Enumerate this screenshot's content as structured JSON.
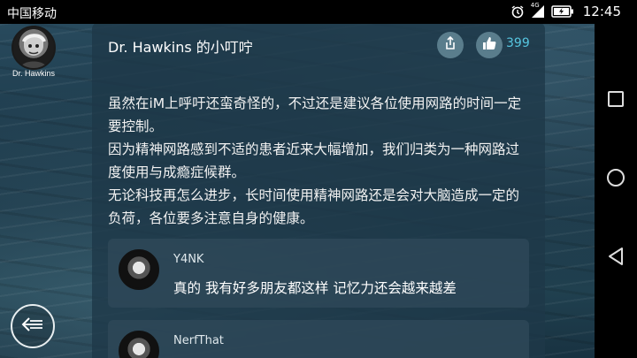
{
  "status_bar": {
    "carrier": "中国移动",
    "network_badge": "4G",
    "time": "12:45"
  },
  "author": {
    "name": "Dr. Hawkins"
  },
  "post": {
    "title": "Dr. Hawkins 的小叮咛",
    "like_count": "399",
    "paragraphs": [
      "虽然在iM上呼吁还蛮奇怪的，不过还是建议各位使用网路的时间一定要控制。",
      "因为精神网路感到不适的患者近来大幅增加，我们归类为一种网路过度使用与成瘾症候群。",
      "无论科技再怎么进步，长时间使用精神网路还是会对大脑造成一定的负荷，各位要多注意自身的健康。"
    ]
  },
  "comments": [
    {
      "user": "Y4NK",
      "text": "真的 我有好多朋友都这样 记忆力还会越来越差"
    },
    {
      "user": "NerfThat",
      "text": ""
    }
  ],
  "colors": {
    "accent": "#56c6e0",
    "card_bg": "#1e3848",
    "button_bg": "#5a7d8c"
  },
  "icons": {
    "share": "share-icon",
    "like": "thumbs-up-icon",
    "back": "back-arrow-icon",
    "recent": "recent-apps-icon",
    "home": "home-icon",
    "nav_back": "nav-back-icon"
  }
}
